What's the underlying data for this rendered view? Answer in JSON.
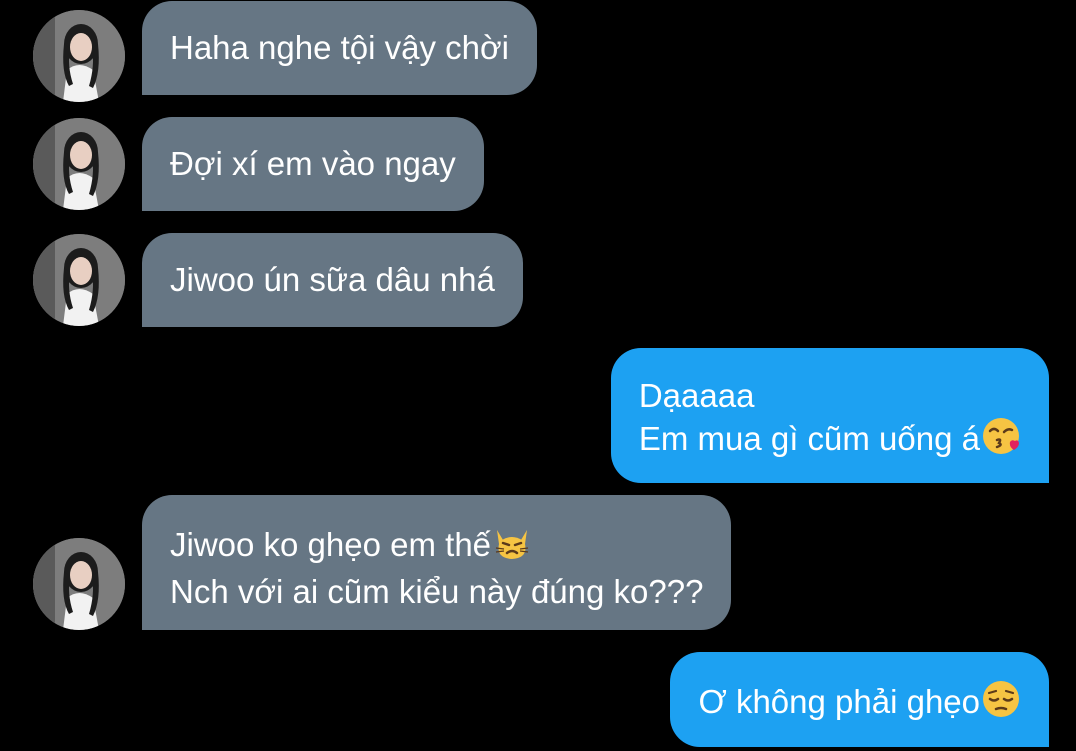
{
  "colors": {
    "background": "#000000",
    "incoming_bubble": "#667684",
    "outgoing_bubble": "#1da1f2",
    "text": "#ffffff"
  },
  "messages": [
    {
      "direction": "incoming",
      "lines": [
        "Haha nghe tội vậy chời"
      ]
    },
    {
      "direction": "incoming",
      "lines": [
        "Đợi xí em vào ngay"
      ]
    },
    {
      "direction": "incoming",
      "lines": [
        "Jiwoo ún sữa dâu nhá"
      ]
    },
    {
      "direction": "outgoing",
      "lines": [
        "Dạaaaa",
        "Em mua gì cũm uống á"
      ],
      "emoji": "kissing-face-icon"
    },
    {
      "direction": "incoming",
      "lines": [
        "Jiwoo ko ghẹo em thế",
        "Nch với ai cũm kiểu này đúng ko???"
      ],
      "emoji": "pouting-cat-icon"
    },
    {
      "direction": "outgoing",
      "lines": [
        "Ơ không phải ghẹo"
      ],
      "emoji": "pensive-face-icon"
    }
  ]
}
